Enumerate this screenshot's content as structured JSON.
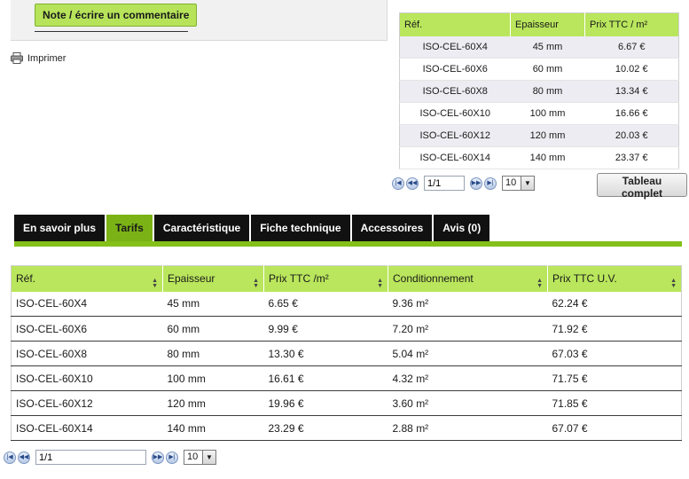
{
  "review_button": "Note / écrire un commentaire",
  "print_label": "Imprimer",
  "small_table": {
    "headers": [
      "Réf.",
      "Epaisseur",
      "Prix TTC / m²"
    ],
    "rows": [
      [
        "ISO-CEL-60X4",
        "45 mm",
        "6.67 €"
      ],
      [
        "ISO-CEL-60X6",
        "60 mm",
        "10.02 €"
      ],
      [
        "ISO-CEL-60X8",
        "80 mm",
        "13.34 €"
      ],
      [
        "ISO-CEL-60X10",
        "100 mm",
        "16.66 €"
      ],
      [
        "ISO-CEL-60X12",
        "120 mm",
        "20.03 €"
      ],
      [
        "ISO-CEL-60X14",
        "140 mm",
        "23.37 €"
      ]
    ],
    "pager": {
      "page": "1/1",
      "per_page": "10"
    }
  },
  "full_table_button": "Tableau complet",
  "tabs": [
    {
      "label": "En savoir plus",
      "active": false
    },
    {
      "label": "Tarifs",
      "active": true
    },
    {
      "label": "Caractéristique",
      "active": false
    },
    {
      "label": "Fiche technique",
      "active": false
    },
    {
      "label": "Accessoires",
      "active": false
    },
    {
      "label": "Avis (0)",
      "active": false
    }
  ],
  "big_table": {
    "headers": [
      "Réf.",
      "Epaisseur",
      "Prix TTC /m²",
      "Conditionnement",
      "Prix TTC U.V."
    ],
    "rows": [
      [
        "ISO-CEL-60X4",
        "45 mm",
        "6.65 €",
        "9.36 m²",
        "62.24 €"
      ],
      [
        "ISO-CEL-60X6",
        "60 mm",
        "9.99 €",
        "7.20 m²",
        "71.92 €"
      ],
      [
        "ISO-CEL-60X8",
        "80 mm",
        "13.30 €",
        "5.04 m²",
        "67.03 €"
      ],
      [
        "ISO-CEL-60X10",
        "100 mm",
        "16.61 €",
        "4.32 m²",
        "71.75 €"
      ],
      [
        "ISO-CEL-60X12",
        "120 mm",
        "19.96 €",
        "3.60 m²",
        "71.85 €"
      ],
      [
        "ISO-CEL-60X14",
        "140 mm",
        "23.29 €",
        "2.88 m²",
        "67.07 €"
      ]
    ],
    "pager": {
      "page": "1/1",
      "per_page": "10"
    }
  }
}
